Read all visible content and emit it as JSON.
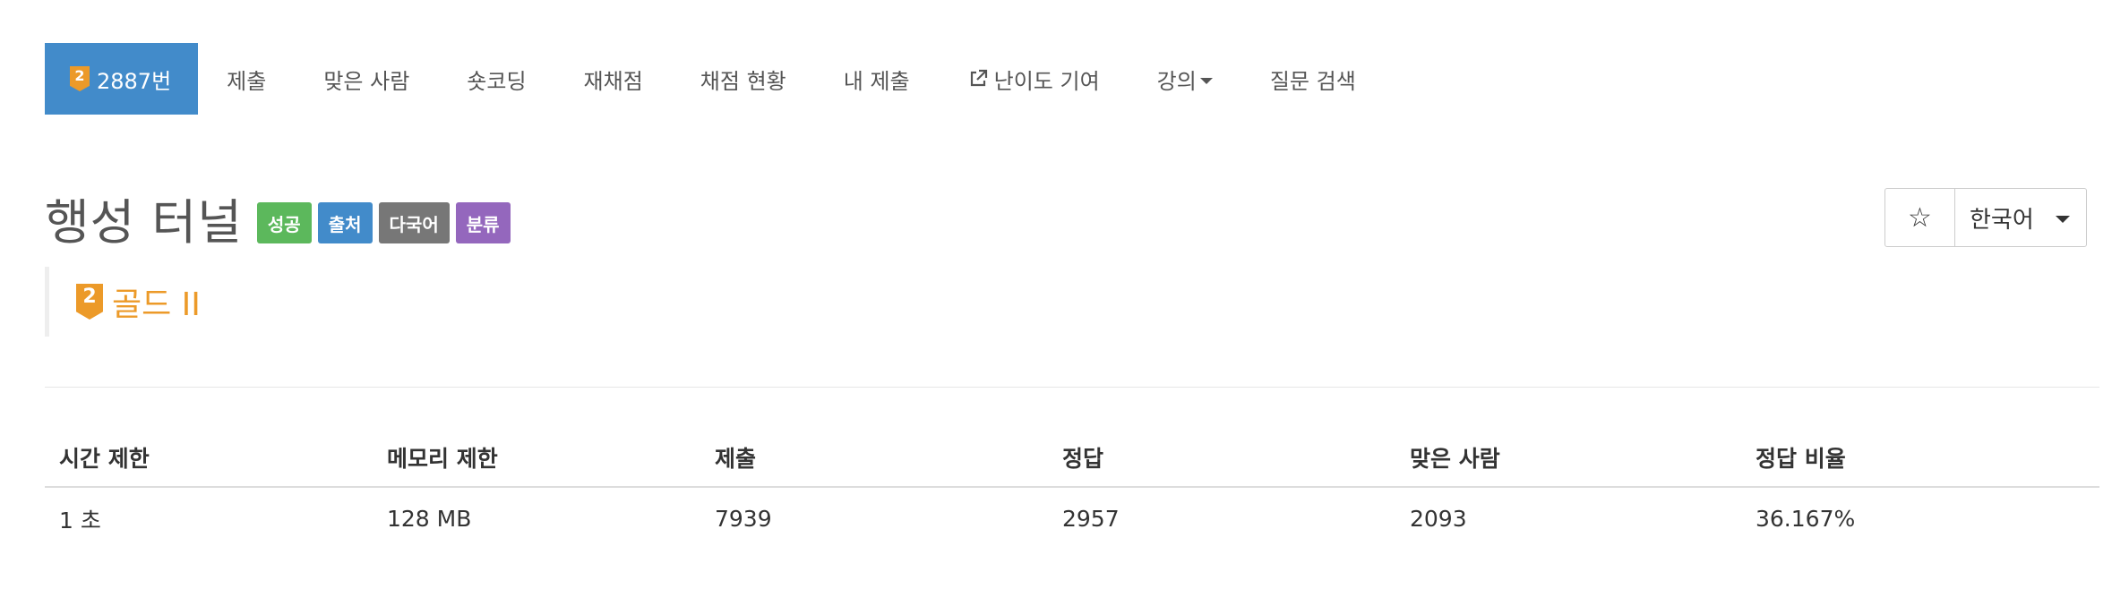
{
  "nav": {
    "problem_number": "2887번",
    "tier_badge": "2",
    "items": [
      {
        "label": "제출"
      },
      {
        "label": "맞은 사람"
      },
      {
        "label": "숏코딩"
      },
      {
        "label": "재채점"
      },
      {
        "label": "채점 현황"
      },
      {
        "label": "내 제출"
      },
      {
        "label": "난이도 기여",
        "icon": "external-link-icon"
      },
      {
        "label": "강의",
        "icon": "caret-down-icon"
      },
      {
        "label": "질문 검색"
      }
    ]
  },
  "problem": {
    "title": "행성 터널",
    "labels": {
      "success": "성공",
      "source": "출처",
      "multi": "다국어",
      "category": "분류"
    },
    "tier_number": "2",
    "tier_text": "골드 II"
  },
  "controls": {
    "star_icon": "☆",
    "language": "한국어"
  },
  "info": {
    "headers": [
      "시간 제한",
      "메모리 제한",
      "제출",
      "정답",
      "맞은 사람",
      "정답 비율"
    ],
    "values": [
      "1 초",
      "128 MB",
      "7939",
      "2957",
      "2093",
      "36.167%"
    ]
  },
  "colors": {
    "accent": "#428bca",
    "gold": "#ec9a29",
    "success": "#5cb85c",
    "muted": "#777777",
    "category": "#9467bd"
  }
}
